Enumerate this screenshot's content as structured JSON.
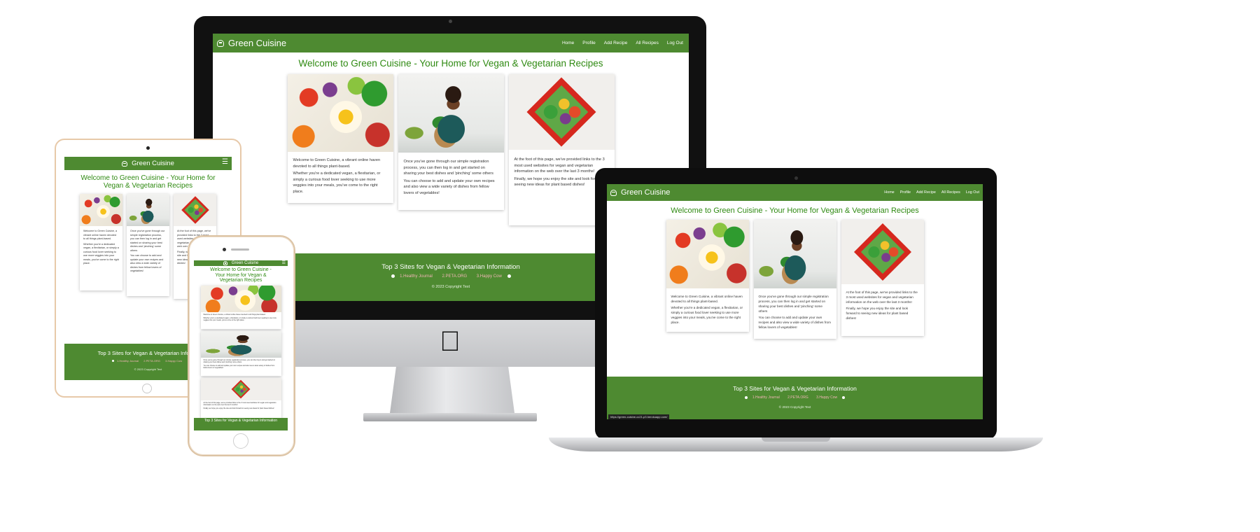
{
  "site": {
    "brand": "Green Cuisine",
    "nav": [
      "Home",
      "Profile",
      "Add Recipe",
      "All Recipes",
      "Log Out"
    ],
    "hero_title": "Welcome to Green Cuisine - Your Home for Vegan & Vegetarian Recipes",
    "hero_title_tablet_line1": "Welcome to Green Cuisine - Your Home for",
    "hero_title_tablet_line2": "Vegan & Vegetarian Recipes",
    "hero_title_phone_line1": "Welcome to Green Cuisine -",
    "hero_title_phone_line2": "Your Home for Vegan &",
    "hero_title_phone_line3": "Vegetarian Recipes",
    "cards": [
      {
        "image": "salad-plate",
        "text1": "Welcome to Green Cuisine, a vibrant online haven devoted to all things plant-based.",
        "text2": "Whether you're a dedicated vegan, a flexitarian, or simply a curious food lover seeking to use more veggies into your meals, you've come to the right place."
      },
      {
        "image": "woman-cooking",
        "text1": "Once you've gone through our simple registration process, you can then log in and get started on sharing your best dishes and 'pinching' some others",
        "text2": "You can choose to add and update your own recipes and also view a wide variety of dishes from fellow lovers of vegetables!"
      },
      {
        "image": "heart-bowl",
        "text1": "At the foot of this page, we've provided links to the 3 most used websites for vegan and vegetarian information on the web over the last 3 months!",
        "text2": "Finally, we hope you enjoy the site and look forward to seeing new ideas for plant based dishes!"
      }
    ],
    "footer_title": "Top 3 Sites for Vegan & Vegetarian Information",
    "footer_title_tablet": "Top 3 Sites for Vegan & Vegetarian Informa",
    "footer_links": [
      "1.Healthy Journal",
      "2.PETA.ORG",
      "3.Happy Cow"
    ],
    "copyright": "© 2023 Copyright Text",
    "status_url": "https://green-cuisine-cc21-p3.herokuapp.com/"
  },
  "devices": {
    "desktop": "iMac",
    "laptop": "MacBook",
    "tablet": "iPad",
    "phone": "iPhone"
  },
  "icons": {
    "apple_logo": "apple-logo-icon",
    "brand": "chef-hat-icon",
    "menu": "hamburger-menu-icon",
    "link_dot": "dot-icon"
  },
  "colors": {
    "brand_green": "#4e8a31",
    "title_green": "#2f8a12",
    "link_pink": "#f0b5b5"
  }
}
